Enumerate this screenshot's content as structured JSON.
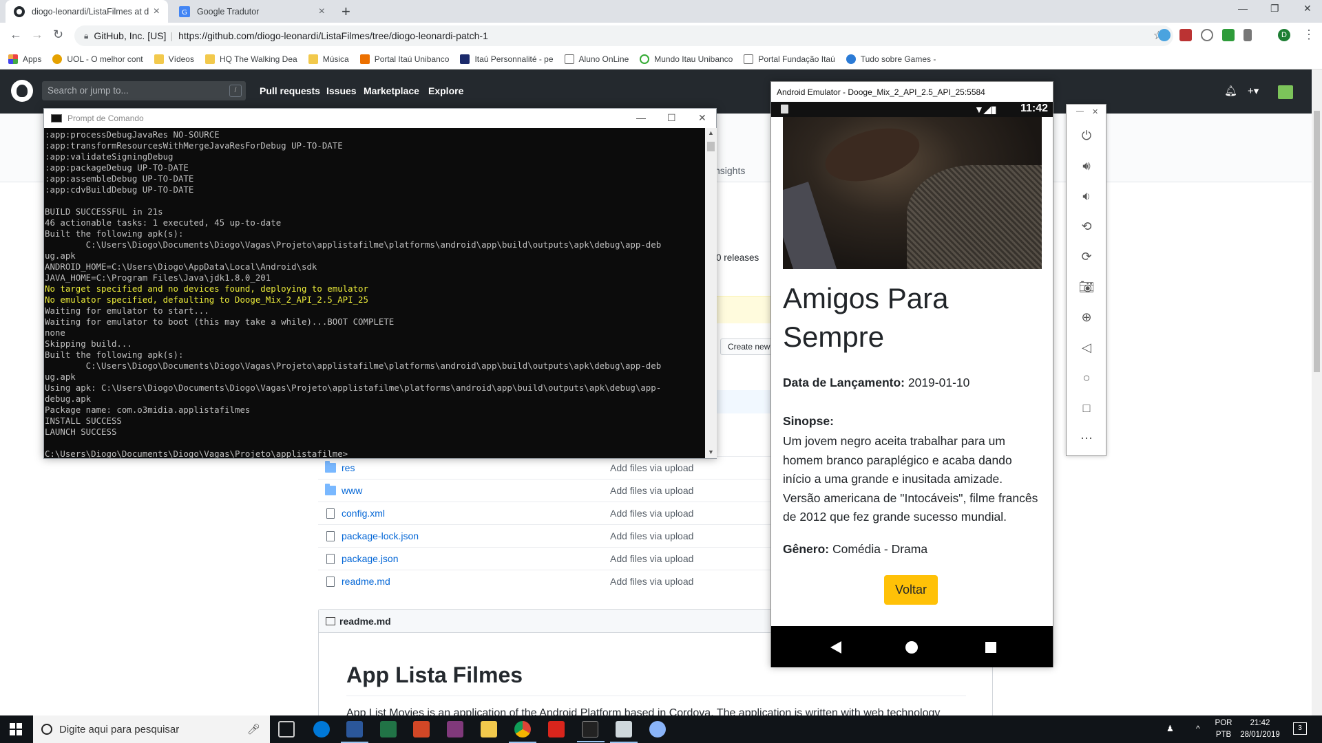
{
  "browser": {
    "tabs": [
      {
        "title": "diogo-leonardi/ListaFilmes at dio",
        "active": true
      },
      {
        "title": "Google Tradutor",
        "active": false
      }
    ],
    "site_identity": "GitHub, Inc. [US]",
    "url": "https://github.com/diogo-leonardi/ListaFilmes/tree/diogo-leonardi-patch-1",
    "profile_initial": "D",
    "bookmarks": [
      "Apps",
      "UOL - O melhor cont",
      "Vídeos",
      "HQ The Walking Dea",
      "Música",
      "Portal Itaú Unibanco",
      "Itaú Personnalité - pe",
      "Aluno OnLine",
      "Mundo Itau Unibanco",
      "Portal Fundação Itaú",
      "Tudo sobre Games -"
    ]
  },
  "github": {
    "search_placeholder": "Search or jump to...",
    "search_shortcut": "/",
    "nav": [
      "Pull requests",
      "Issues",
      "Marketplace",
      "Explore"
    ],
    "insights_tab": "nsights",
    "releases": "0 releases",
    "create_new": "Create new",
    "files": [
      {
        "name": "res",
        "type": "folder",
        "message": "Add files via upload"
      },
      {
        "name": "www",
        "type": "folder",
        "message": "Add files via upload"
      },
      {
        "name": "config.xml",
        "type": "file",
        "message": "Add files via upload"
      },
      {
        "name": "package-lock.json",
        "type": "file",
        "message": "Add files via upload"
      },
      {
        "name": "package.json",
        "type": "file",
        "message": "Add files via upload"
      },
      {
        "name": "readme.md",
        "type": "file",
        "message": "Add files via upload"
      }
    ],
    "readme_label": "readme.md",
    "readme_title": "App Lista Filmes",
    "readme_text": "App List Movies is an application of the Android Platform based in Cordova. The application is written with web technology"
  },
  "cmd": {
    "title": "Prompt de Comando",
    "lines": [
      {
        "text": ":app:processDebugJavaRes NO-SOURCE",
        "hl": false
      },
      {
        "text": ":app:transformResourcesWithMergeJavaResForDebug UP-TO-DATE",
        "hl": false
      },
      {
        "text": ":app:validateSigningDebug",
        "hl": false
      },
      {
        "text": ":app:packageDebug UP-TO-DATE",
        "hl": false
      },
      {
        "text": ":app:assembleDebug UP-TO-DATE",
        "hl": false
      },
      {
        "text": ":app:cdvBuildDebug UP-TO-DATE",
        "hl": false
      },
      {
        "text": "",
        "hl": false
      },
      {
        "text": "BUILD SUCCESSFUL in 21s",
        "hl": false
      },
      {
        "text": "46 actionable tasks: 1 executed, 45 up-to-date",
        "hl": false
      },
      {
        "text": "Built the following apk(s):",
        "hl": false
      },
      {
        "text": "        C:\\Users\\Diogo\\Documents\\Diogo\\Vagas\\Projeto\\applistafilme\\platforms\\android\\app\\build\\outputs\\apk\\debug\\app-deb",
        "hl": false
      },
      {
        "text": "ug.apk",
        "hl": false
      },
      {
        "text": "ANDROID_HOME=C:\\Users\\Diogo\\AppData\\Local\\Android\\sdk",
        "hl": false
      },
      {
        "text": "JAVA_HOME=C:\\Program Files\\Java\\jdk1.8.0_201",
        "hl": false
      },
      {
        "text": "No target specified and no devices found, deploying to emulator",
        "hl": true
      },
      {
        "text": "No emulator specified, defaulting to Dooge_Mix_2_API_2.5_API_25",
        "hl": true
      },
      {
        "text": "Waiting for emulator to start...",
        "hl": false
      },
      {
        "text": "Waiting for emulator to boot (this may take a while)...BOOT COMPLETE",
        "hl": false
      },
      {
        "text": "none",
        "hl": false
      },
      {
        "text": "Skipping build...",
        "hl": false
      },
      {
        "text": "Built the following apk(s):",
        "hl": false
      },
      {
        "text": "        C:\\Users\\Diogo\\Documents\\Diogo\\Vagas\\Projeto\\applistafilme\\platforms\\android\\app\\build\\outputs\\apk\\debug\\app-deb",
        "hl": false
      },
      {
        "text": "ug.apk",
        "hl": false
      },
      {
        "text": "Using apk: C:\\Users\\Diogo\\Documents\\Diogo\\Vagas\\Projeto\\applistafilme\\platforms\\android\\app\\build\\outputs\\apk\\debug\\app-",
        "hl": false
      },
      {
        "text": "debug.apk",
        "hl": false
      },
      {
        "text": "Package name: com.o3midia.applistafilmes",
        "hl": false
      },
      {
        "text": "INSTALL SUCCESS",
        "hl": false
      },
      {
        "text": "LAUNCH SUCCESS",
        "hl": false
      },
      {
        "text": "",
        "hl": false
      },
      {
        "text": "C:\\Users\\Diogo\\Documents\\Diogo\\Vagas\\Projeto\\applistafilme>",
        "hl": false
      }
    ]
  },
  "emulator": {
    "title": "Android Emulator - Dooge_Mix_2_API_2.5_API_25:5584",
    "time": "11:42",
    "movie_title": "Amigos Para Sempre",
    "release_label": "Data de Lançamento:",
    "release_value": "2019-01-10",
    "synopsis_label": "Sinopse:",
    "synopsis": "Um jovem negro aceita trabalhar para um homem branco paraplégico e acaba dando início a uma grande e inusitada amizade. Versão americana de \"Intocáveis\", filme francês de 2012 que fez grande sucesso mundial.",
    "genre_label": "Gênero:",
    "genre_value": "Comédia - Drama",
    "back_button": "Voltar",
    "side_tools": [
      "power-icon",
      "volume-up-icon",
      "volume-down-icon",
      "rotate-left-icon",
      "rotate-right-icon",
      "camera-icon",
      "zoom-icon",
      "back-icon",
      "home-icon",
      "overview-icon",
      "more-icon"
    ]
  },
  "taskbar": {
    "search_placeholder": "Digite aqui para pesquisar",
    "lang_top": "POR",
    "lang_bottom": "PTB",
    "time": "21:42",
    "date": "28/01/2019",
    "notifications": "3"
  }
}
